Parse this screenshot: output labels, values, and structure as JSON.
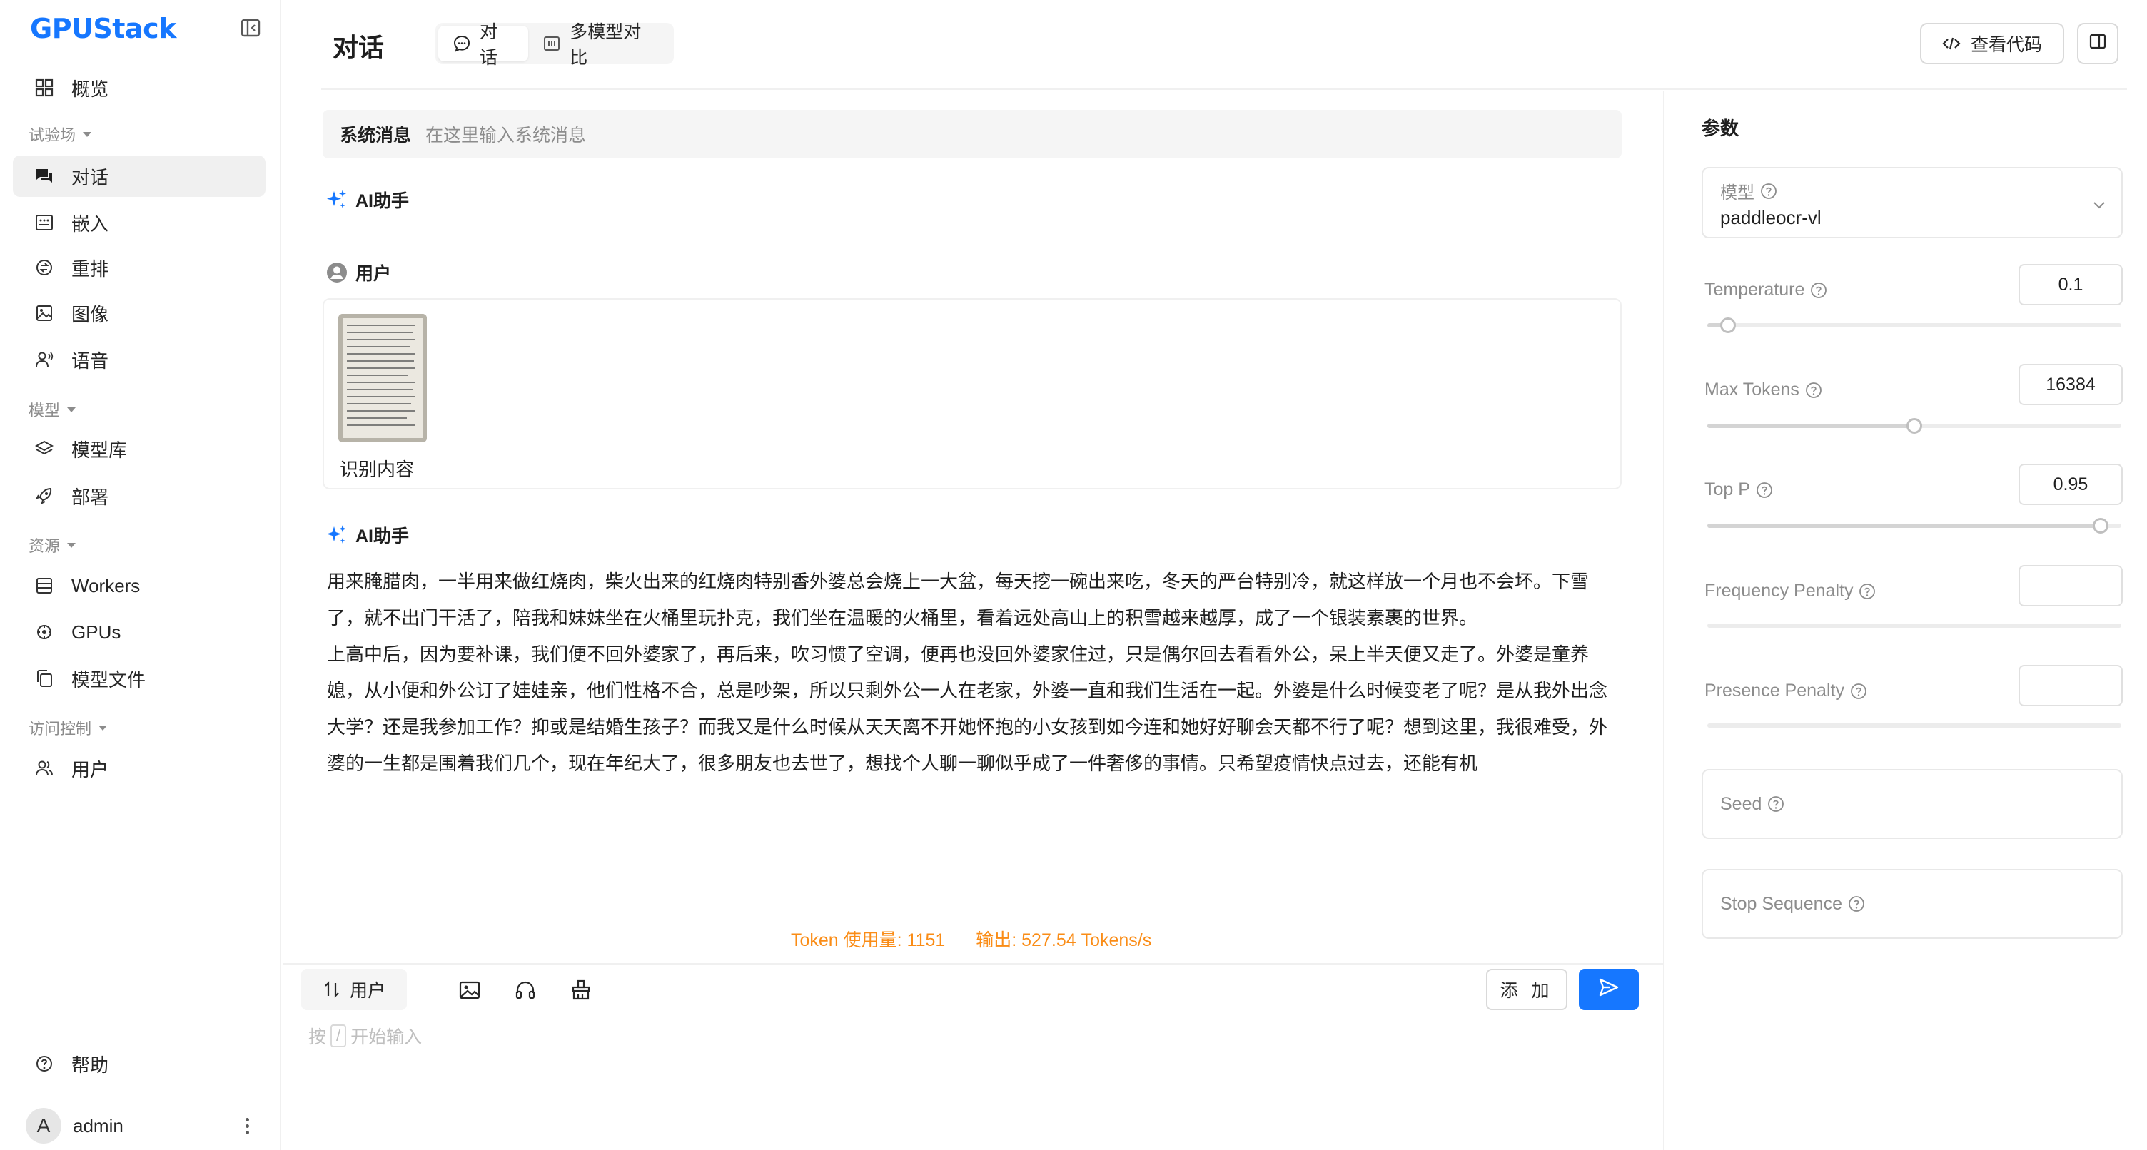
{
  "app": {
    "logo": "GPUStack"
  },
  "sidebar": {
    "items": [
      {
        "label": "概览",
        "icon": "dashboard-icon"
      },
      {
        "label": "对话",
        "icon": "chat-icon",
        "active": true
      },
      {
        "label": "嵌入",
        "icon": "embedding-icon"
      },
      {
        "label": "重排",
        "icon": "rerank-icon"
      },
      {
        "label": "图像",
        "icon": "image-icon"
      },
      {
        "label": "语音",
        "icon": "speech-icon"
      },
      {
        "label": "模型库",
        "icon": "layers-icon"
      },
      {
        "label": "部署",
        "icon": "rocket-icon"
      },
      {
        "label": "Workers",
        "icon": "server-icon"
      },
      {
        "label": "GPUs",
        "icon": "gpu-icon"
      },
      {
        "label": "模型文件",
        "icon": "files-icon"
      },
      {
        "label": "用户",
        "icon": "users-icon"
      }
    ],
    "groups": {
      "playground": "试验场",
      "models": "模型",
      "resources": "资源",
      "access": "访问控制"
    },
    "help": "帮助",
    "user": {
      "avatar_letter": "A",
      "name": "admin"
    }
  },
  "header": {
    "title": "对话",
    "tabs": [
      {
        "label": "对话",
        "active": true
      },
      {
        "label": "多模型对比",
        "active": false
      }
    ],
    "view_code": "查看代码"
  },
  "chat": {
    "system_label": "系统消息",
    "system_placeholder": "在这里输入系统消息",
    "assistant_label": "AI助手",
    "user_label": "用户",
    "user_text": "识别内容",
    "assistant_paragraphs": [
      "用来腌腊肉，一半用来做红烧肉，柴火出来的红烧肉特别香外婆总会烧上一大盆，每天挖一碗出来吃，冬天的严台特别冷，就这样放一个月也不会坏。下雪了，就不出门干活了，陪我和妹妹坐在火桶里玩扑克，我们坐在温暖的火桶里，看着远处高山上的积雪越来越厚，成了一个银装素裹的世界。",
      "上高中后，因为要补课，我们便不回外婆家了，再后来，吹习惯了空调，便再也没回外婆家住过，只是偶尔回去看看外公，呆上半天便又走了。外婆是童养媳，从小便和外公订了娃娃亲，他们性格不合，总是吵架，所以只剩外公一人在老家，外婆一直和我们生活在一起。外婆是什么时候变老了呢？是从我外出念大学？还是我参加工作？抑或是结婚生孩子？而我又是什么时候从天天离不开她怀抱的小女孩到如今连和她好好聊会天都不行了呢？想到这里，我很难受，外婆的一生都是围着我们几个，现在年纪大了，很多朋友也去世了，想找个人聊一聊似乎成了一件奢侈的事情。只希望疫情快点过去，还能有机"
    ],
    "token_usage": "Token 使用量: 1151",
    "output_speed": "输出: 527.54 Tokens/s"
  },
  "input": {
    "role": "用户",
    "add_label": "添 加",
    "hint_prefix": "按",
    "hint_key": "/",
    "hint_suffix": "开始输入"
  },
  "params": {
    "title": "参数",
    "model_label": "模型",
    "model_value": "paddleocr-vl",
    "temperature": {
      "label": "Temperature",
      "value": "0.1",
      "fraction": 0.05
    },
    "max_tokens": {
      "label": "Max Tokens",
      "value": "16384",
      "fraction": 0.5
    },
    "top_p": {
      "label": "Top P",
      "value": "0.95",
      "fraction": 0.95
    },
    "frequency_penalty": {
      "label": "Frequency Penalty",
      "value": ""
    },
    "presence_penalty": {
      "label": "Presence Penalty",
      "value": ""
    },
    "seed": {
      "label": "Seed"
    },
    "stop_sequence": {
      "label": "Stop Sequence"
    }
  },
  "colors": {
    "accent": "#1677ff",
    "token_usage": "#fa8c16"
  }
}
